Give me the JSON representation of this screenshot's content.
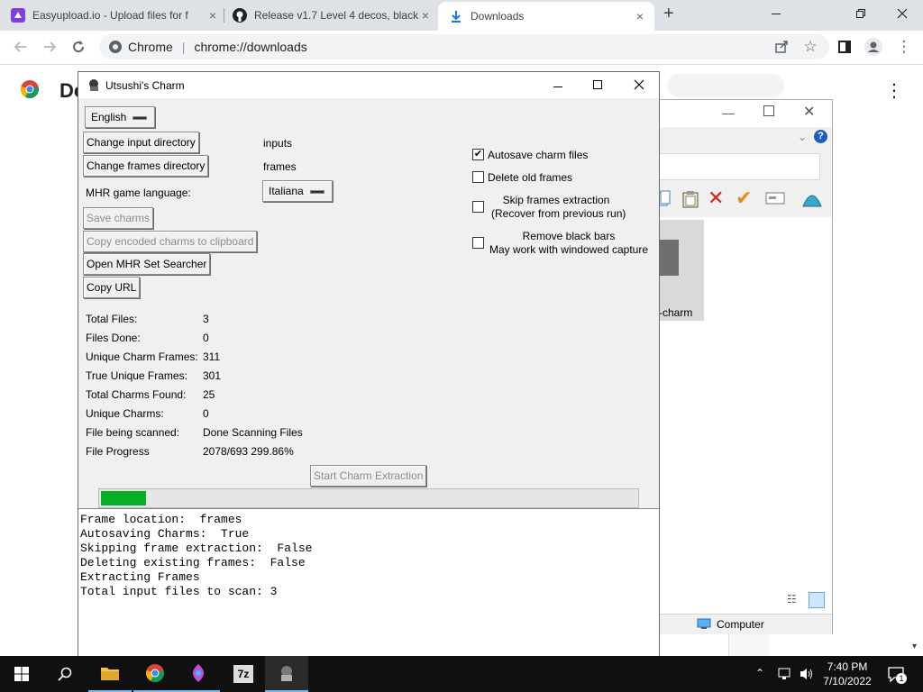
{
  "browser": {
    "tabs": [
      {
        "title": "Easyupload.io - Upload files for f",
        "close": "×"
      },
      {
        "title": "Release v1.7 Level 4 decos, black",
        "close": "×"
      },
      {
        "title": "Downloads",
        "close": "×"
      }
    ],
    "new_tab": "+",
    "omnibox_chip": "Chrome",
    "url": "chrome://downloads",
    "page_title": "Do"
  },
  "explorer": {
    "file_caption": "-charm",
    "computer_label": "Computer"
  },
  "app": {
    "title": "Utsushi's Charm",
    "language_menu": "English",
    "change_input_dir": "Change input directory",
    "input_dir_value": "inputs",
    "change_frames_dir": "Change frames directory",
    "frames_dir_value": "frames",
    "game_language_label": "MHR game language:",
    "game_language_value": "Italiana",
    "save_charms": "Save charms",
    "copy_encoded": "Copy encoded charms to clipboard",
    "open_set_searcher": "Open MHR Set Searcher",
    "copy_url": "Copy URL",
    "options": {
      "autosave": "Autosave charm files",
      "delete_old": "Delete old frames",
      "skip_line1": "Skip frames extraction",
      "skip_line2": "(Recover from previous run)",
      "remove_bars_line1": "Remove black bars",
      "remove_bars_line2": "May work with windowed capture"
    },
    "checked_mark": "✔",
    "stats": [
      {
        "label": "Total Files:",
        "value": "3"
      },
      {
        "label": "Files Done:",
        "value": "0"
      },
      {
        "label": "Unique Charm Frames:",
        "value": "311"
      },
      {
        "label": "True Unique Frames:",
        "value": "301"
      },
      {
        "label": "Total Charms Found:",
        "value": "25"
      },
      {
        "label": "Unique Charms:",
        "value": "0"
      },
      {
        "label": "File being scanned:",
        "value": "Done Scanning Files"
      },
      {
        "label": "File Progress",
        "value": "2078/693 299.86%"
      }
    ],
    "start_extraction": "Start Charm Extraction",
    "progress_fraction": 0.085,
    "progress_color": "#06b025",
    "console_lines": [
      "Frame location:  frames",
      "Autosaving Charms:  True",
      "Skipping frame extraction:  False",
      "Deleting existing frames:  False",
      "Extracting Frames",
      "Total input files to scan: 3"
    ]
  },
  "taskbar": {
    "time": "7:40 PM",
    "date": "7/10/2022",
    "notification_count": "1"
  }
}
